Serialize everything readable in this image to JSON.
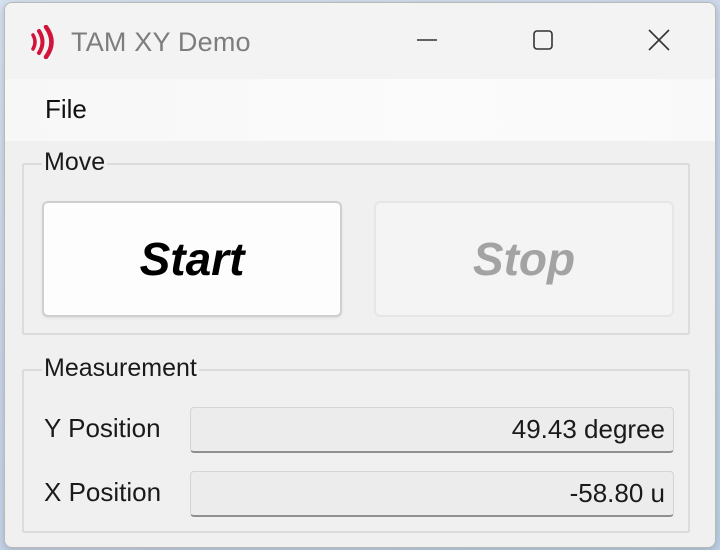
{
  "window": {
    "title": "TAM XY Demo",
    "accent_color": "#d2143a",
    "controls": {
      "minimize_icon": "minimize-icon",
      "maximize_icon": "maximize-icon",
      "close_icon": "close-icon"
    }
  },
  "menu": {
    "items": [
      {
        "label": "File"
      }
    ]
  },
  "move": {
    "label": "Move",
    "start_label": "Start",
    "stop_label": "Stop",
    "stop_enabled": false
  },
  "measurement": {
    "label": "Measurement",
    "y_label": "Y Position",
    "y_value": "49.43 degree",
    "x_label": "X Position",
    "x_value": "-58.80 u"
  }
}
